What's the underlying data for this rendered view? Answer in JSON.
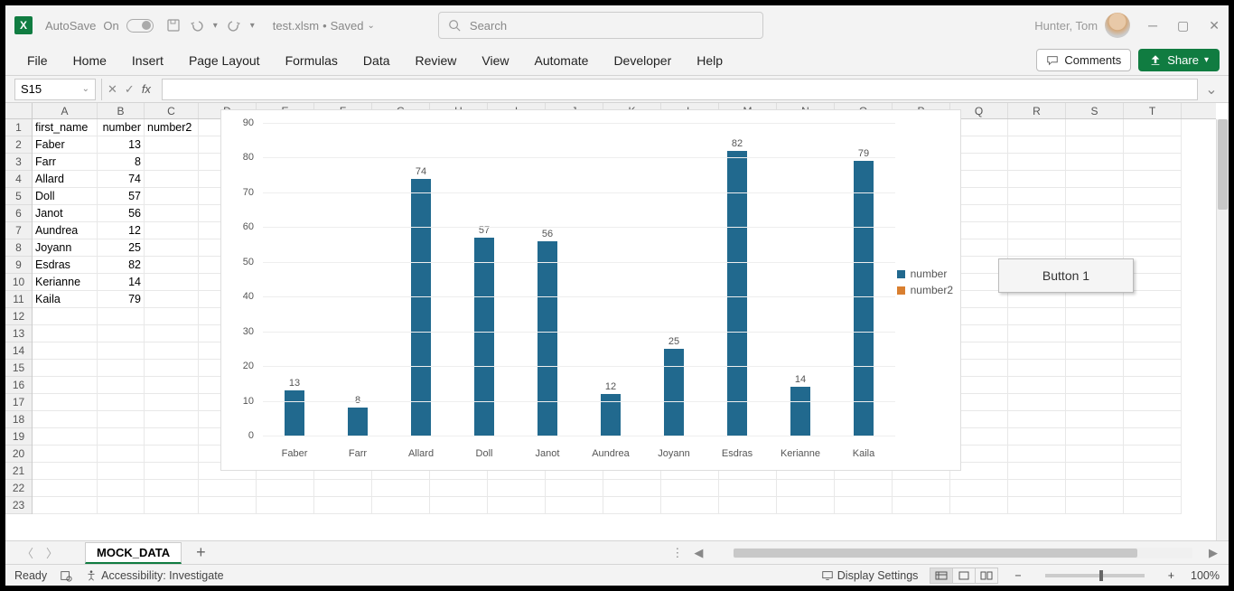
{
  "title": {
    "autosave_label": "AutoSave",
    "autosave_state": "On",
    "filename": "test.xlsm",
    "saved_state": "Saved",
    "search_placeholder": "Search",
    "user_name": "Hunter, Tom"
  },
  "ribbon": {
    "tabs": [
      "File",
      "Home",
      "Insert",
      "Page Layout",
      "Formulas",
      "Data",
      "Review",
      "View",
      "Automate",
      "Developer",
      "Help"
    ],
    "comments_label": "Comments",
    "share_label": "Share"
  },
  "formula_bar": {
    "name_box": "S15",
    "formula": ""
  },
  "columns": [
    "A",
    "B",
    "C",
    "D",
    "E",
    "F",
    "G",
    "H",
    "I",
    "J",
    "K",
    "L",
    "M",
    "N",
    "O",
    "P",
    "Q",
    "R",
    "S",
    "T"
  ],
  "row_count": 23,
  "table": {
    "headers": [
      "first_name",
      "number",
      "number2"
    ],
    "rows": [
      {
        "first_name": "Faber",
        "number": 13
      },
      {
        "first_name": "Farr",
        "number": 8
      },
      {
        "first_name": "Allard",
        "number": 74
      },
      {
        "first_name": "Doll",
        "number": 57
      },
      {
        "first_name": "Janot",
        "number": 56
      },
      {
        "first_name": "Aundrea",
        "number": 12
      },
      {
        "first_name": "Joyann",
        "number": 25
      },
      {
        "first_name": "Esdras",
        "number": 82
      },
      {
        "first_name": "Kerianne",
        "number": 14
      },
      {
        "first_name": "Kaila",
        "number": 79
      }
    ]
  },
  "chart_data": {
    "type": "bar",
    "categories": [
      "Faber",
      "Farr",
      "Allard",
      "Doll",
      "Janot",
      "Aundrea",
      "Joyann",
      "Esdras",
      "Kerianne",
      "Kaila"
    ],
    "series": [
      {
        "name": "number",
        "color": "#21698e",
        "values": [
          13,
          8,
          74,
          57,
          56,
          12,
          25,
          82,
          14,
          79
        ]
      },
      {
        "name": "number2",
        "color": "#d97f30",
        "values": []
      }
    ],
    "y_ticks": [
      0,
      10,
      20,
      30,
      40,
      50,
      60,
      70,
      80,
      90
    ],
    "ylim": [
      0,
      90
    ]
  },
  "vba_button": "Button 1",
  "sheet": {
    "active": "MOCK_DATA"
  },
  "status": {
    "ready": "Ready",
    "accessibility": "Accessibility: Investigate",
    "display_settings": "Display Settings",
    "zoom": "100%"
  }
}
